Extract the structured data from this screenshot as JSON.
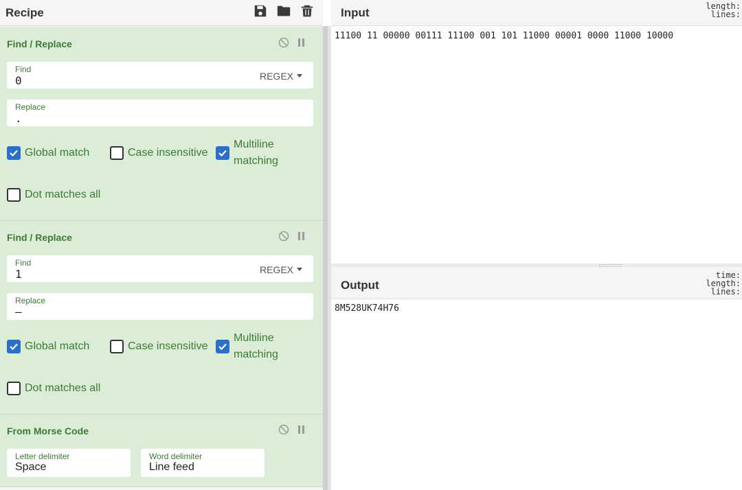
{
  "recipe": {
    "title": "Recipe",
    "icons": [
      "save-icon",
      "folder-icon",
      "trash-icon"
    ],
    "operations": [
      {
        "title": "Find / Replace",
        "find_label": "Find",
        "find_value": "0",
        "regex_label": "REGEX",
        "replace_label": "Replace",
        "replace_value": ".",
        "global_match": "Global match",
        "case_insensitive": "Case insensitive",
        "multiline_1": "Multiline",
        "multiline_2": "matching",
        "dot_matches_all": "Dot matches all",
        "checked": {
          "global_match": true,
          "case_insensitive": false,
          "multiline": true,
          "dot_matches_all": false
        }
      },
      {
        "title": "Find / Replace",
        "find_label": "Find",
        "find_value": "1",
        "regex_label": "REGEX",
        "replace_label": "Replace",
        "replace_value": "–",
        "global_match": "Global match",
        "case_insensitive": "Case insensitive",
        "multiline_1": "Multiline",
        "multiline_2": "matching",
        "dot_matches_all": "Dot matches all",
        "checked": {
          "global_match": true,
          "case_insensitive": false,
          "multiline": true,
          "dot_matches_all": false
        }
      },
      {
        "title": "From Morse Code",
        "letter_delim_label": "Letter delimiter",
        "letter_delim_value": "Space",
        "word_delim_label": "Word delimiter",
        "word_delim_value": "Line feed"
      }
    ]
  },
  "input": {
    "title": "Input",
    "stat_1": "length:",
    "stat_2": "lines:",
    "text": "11100 11 00000 00111 11100 001 101 11000 00001 0000 11000 10000"
  },
  "output": {
    "title": "Output",
    "stat_1": "time:",
    "stat_2": "length:",
    "stat_3": "lines:",
    "text": "8M528UK74H76"
  },
  "colors": {
    "op_bg": "#dcedd7",
    "op_text": "#3c7a36",
    "checkbox_on": "#2a70c8"
  }
}
